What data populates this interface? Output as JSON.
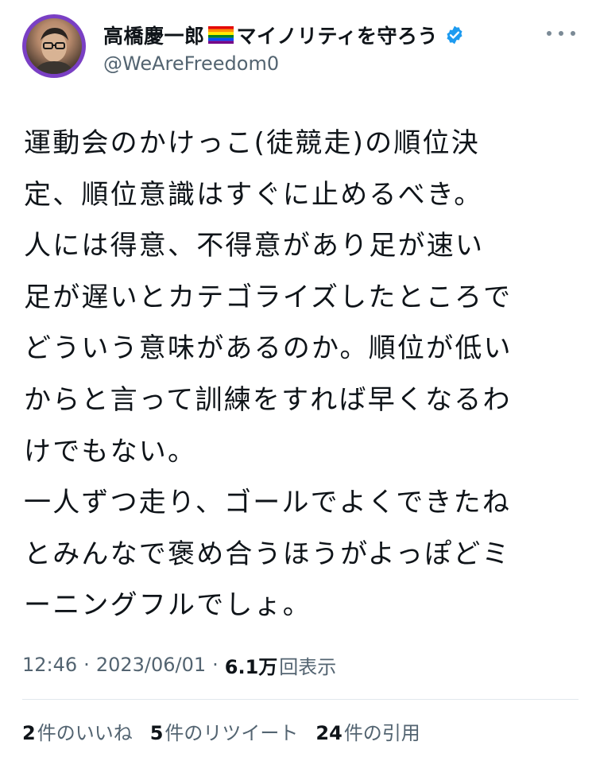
{
  "author": {
    "name": "高橋慶一郎",
    "name_suffix": "マイノリティを守ろう",
    "handle": "@WeAreFreedom0",
    "flag_icon": "rainbow-flag",
    "verified_icon": "verified-badge",
    "verified_color": "#1d9bf0",
    "avatar_ring_color": "#7a3fc4"
  },
  "tweet": {
    "lines": [
      "運動会のかけっこ(徒競走)の順位決",
      "定、順位意識はすぐに止めるべき。",
      "人には得意、不得意があり足が速い",
      "足が遅いとカテゴライズしたところで",
      "どういう意味があるのか。順位が低い",
      "からと言って訓練をすれば早くなるわ",
      "けでもない。",
      "一人ずつ走り、ゴールでよくできたね",
      "とみんなで褒め合うほうがよっぽどミ",
      "ーニングフルでしょ。"
    ]
  },
  "meta": {
    "time": "12:46",
    "separator": "·",
    "date": "2023/06/01",
    "views_count": "6.1万",
    "views_label": "回表示"
  },
  "stats": {
    "likes_count": "2",
    "likes_label": "件のいいね",
    "retweets_count": "5",
    "retweets_label": "件のリツイート",
    "quotes_count": "24",
    "quotes_label": "件の引用"
  },
  "colors": {
    "text": "#0f1419",
    "secondary": "#536471",
    "divider": "#e1e8ed"
  },
  "more_icon": "more-horizontal-icon"
}
